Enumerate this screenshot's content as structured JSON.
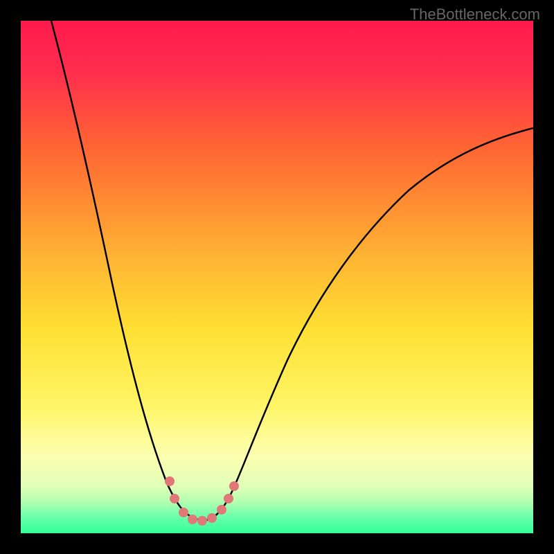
{
  "watermark": "TheBottleneck.com",
  "chart_data": {
    "type": "line",
    "title": "",
    "xlabel": "",
    "ylabel": "",
    "xlim": [
      0,
      100
    ],
    "ylim": [
      0,
      100
    ],
    "gradient_colors": {
      "top": "#ff1a4d",
      "mid_upper": "#ff6633",
      "mid": "#ffcc33",
      "mid_lower": "#ffff66",
      "lower": "#ccff99",
      "bottom": "#33ff99"
    },
    "series": [
      {
        "name": "bottleneck-curve",
        "description": "V-shaped curve with minimum around x=35",
        "points": [
          {
            "x": 6,
            "y": 100
          },
          {
            "x": 10,
            "y": 85
          },
          {
            "x": 15,
            "y": 65
          },
          {
            "x": 20,
            "y": 45
          },
          {
            "x": 25,
            "y": 25
          },
          {
            "x": 28,
            "y": 12
          },
          {
            "x": 30,
            "y": 6
          },
          {
            "x": 32,
            "y": 3
          },
          {
            "x": 35,
            "y": 2
          },
          {
            "x": 38,
            "y": 3
          },
          {
            "x": 40,
            "y": 5
          },
          {
            "x": 43,
            "y": 9
          },
          {
            "x": 48,
            "y": 18
          },
          {
            "x": 55,
            "y": 32
          },
          {
            "x": 65,
            "y": 48
          },
          {
            "x": 75,
            "y": 60
          },
          {
            "x": 85,
            "y": 69
          },
          {
            "x": 95,
            "y": 76
          },
          {
            "x": 100,
            "y": 79
          }
        ]
      }
    ],
    "markers": [
      {
        "x": 29,
        "y": 8
      },
      {
        "x": 30,
        "y": 5
      },
      {
        "x": 32,
        "y": 3
      },
      {
        "x": 34,
        "y": 2.5
      },
      {
        "x": 36,
        "y": 2.5
      },
      {
        "x": 38,
        "y": 3
      },
      {
        "x": 40,
        "y": 5
      },
      {
        "x": 41,
        "y": 7
      },
      {
        "x": 42,
        "y": 9
      }
    ]
  }
}
